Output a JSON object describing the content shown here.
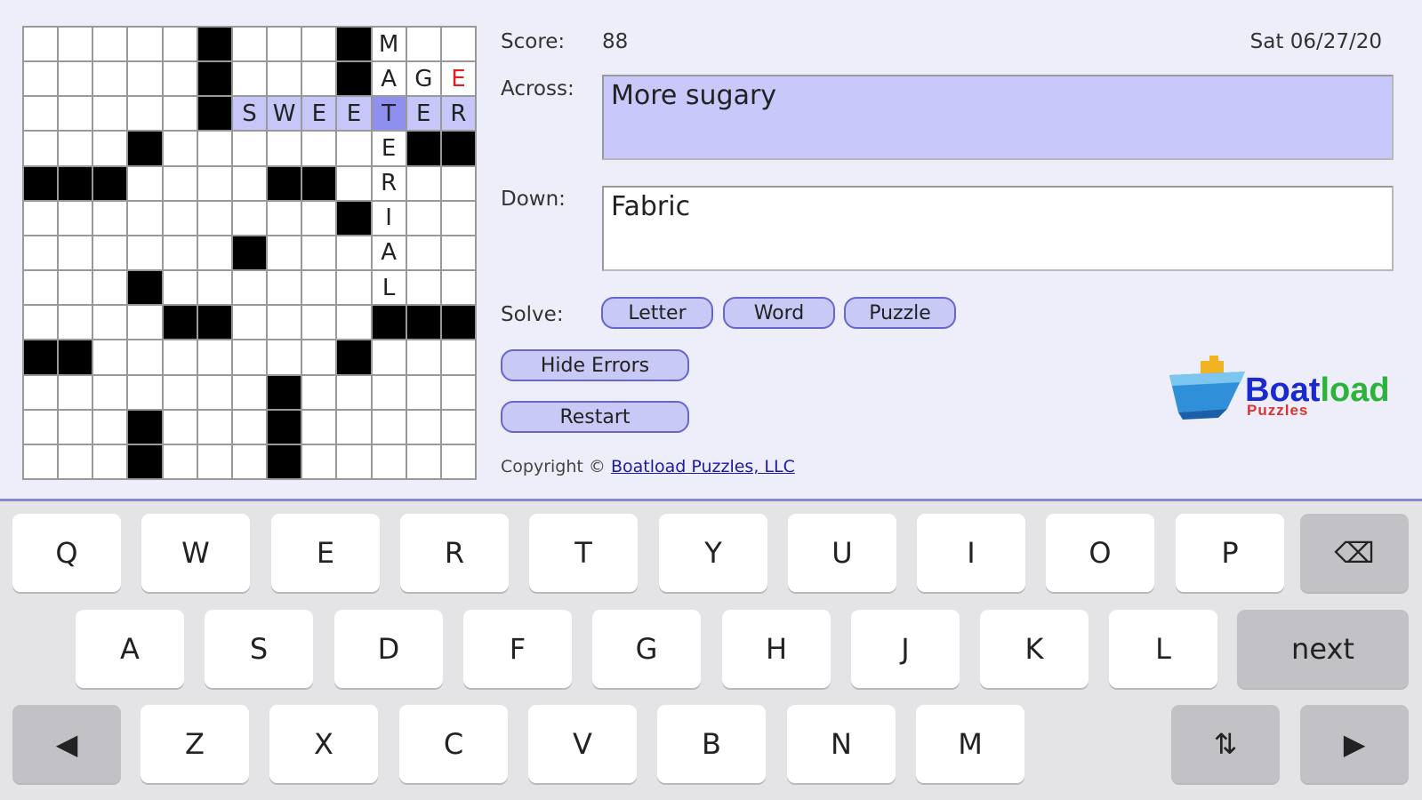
{
  "grid": {
    "rows": [
      [
        "",
        "",
        "",
        "",
        "",
        "#",
        "",
        "",
        "",
        "#",
        "M",
        "",
        ""
      ],
      [
        "",
        "",
        "",
        "",
        "",
        "#",
        "",
        "",
        "",
        "#",
        "A",
        "G",
        "E"
      ],
      [
        "",
        "",
        "",
        "",
        "",
        "#",
        "S",
        "W",
        "E",
        "E",
        "T",
        "E",
        "R"
      ],
      [
        "",
        "",
        "",
        "#",
        "",
        "",
        "",
        "",
        "",
        "",
        "E",
        "#",
        "#"
      ],
      [
        "#",
        "#",
        "#",
        "",
        "",
        "",
        "",
        "#",
        "#",
        "",
        "R",
        "",
        ""
      ],
      [
        "",
        "",
        "",
        "",
        "",
        "",
        "",
        "",
        "",
        "#",
        "I",
        "",
        ""
      ],
      [
        "",
        "",
        "",
        "",
        "",
        "",
        "#",
        "",
        "",
        "",
        "A",
        "",
        ""
      ],
      [
        "",
        "",
        "",
        "#",
        "",
        "",
        "",
        "",
        "",
        "",
        "L",
        "",
        ""
      ],
      [
        "",
        "",
        "",
        "",
        "#",
        "#",
        "",
        "",
        "",
        "",
        "#",
        "#",
        "#"
      ],
      [
        "#",
        "#",
        "",
        "",
        "",
        "",
        "",
        "",
        "",
        "#",
        "",
        "",
        ""
      ],
      [
        "",
        "",
        "",
        "",
        "",
        "",
        "",
        "#",
        "",
        "",
        "",
        "",
        ""
      ],
      [
        "",
        "",
        "",
        "#",
        "",
        "",
        "",
        "#",
        "",
        "",
        "",
        "",
        ""
      ],
      [
        "",
        "",
        "",
        "#",
        "",
        "",
        "",
        "#",
        "",
        "",
        "",
        "",
        ""
      ]
    ],
    "highlight": [
      [
        2,
        6
      ],
      [
        2,
        7
      ],
      [
        2,
        8
      ],
      [
        2,
        9
      ],
      [
        2,
        11
      ],
      [
        2,
        12
      ]
    ],
    "cursor": [
      2,
      10
    ],
    "errors": [
      [
        1,
        12
      ]
    ]
  },
  "header": {
    "score_label": "Score:",
    "score_value": "88",
    "date": "Sat 06/27/20"
  },
  "clues": {
    "across_label": "Across:",
    "across_text": "More sugary",
    "down_label": "Down:",
    "down_text": "Fabric"
  },
  "solve": {
    "label": "Solve:",
    "letter": "Letter",
    "word": "Word",
    "puzzle": "Puzzle"
  },
  "buttons": {
    "hide_errors": "Hide Errors",
    "restart": "Restart"
  },
  "footer": {
    "copyright_prefix": "Copyright ©",
    "copyright_link": "Boatload Puzzles, LLC"
  },
  "logo": {
    "word1": "Boat",
    "word2": "load",
    "sub": "Puzzles"
  },
  "keyboard": {
    "row1": [
      "Q",
      "W",
      "E",
      "R",
      "T",
      "Y",
      "U",
      "I",
      "O",
      "P"
    ],
    "row2": [
      "A",
      "S",
      "D",
      "F",
      "G",
      "H",
      "J",
      "K",
      "L"
    ],
    "row3": [
      "Z",
      "X",
      "C",
      "V",
      "B",
      "N",
      "M"
    ],
    "next": "next",
    "prev_arrow": "◀",
    "next_arrow": "▶",
    "backspace": "⌫",
    "toggle": "⇅"
  },
  "colors": {
    "background": "#eeeefa",
    "highlight": "#c6c6f8",
    "cursor": "#8f8ff0",
    "error_text": "#e02020",
    "button_fill": "#c9c9f6"
  }
}
